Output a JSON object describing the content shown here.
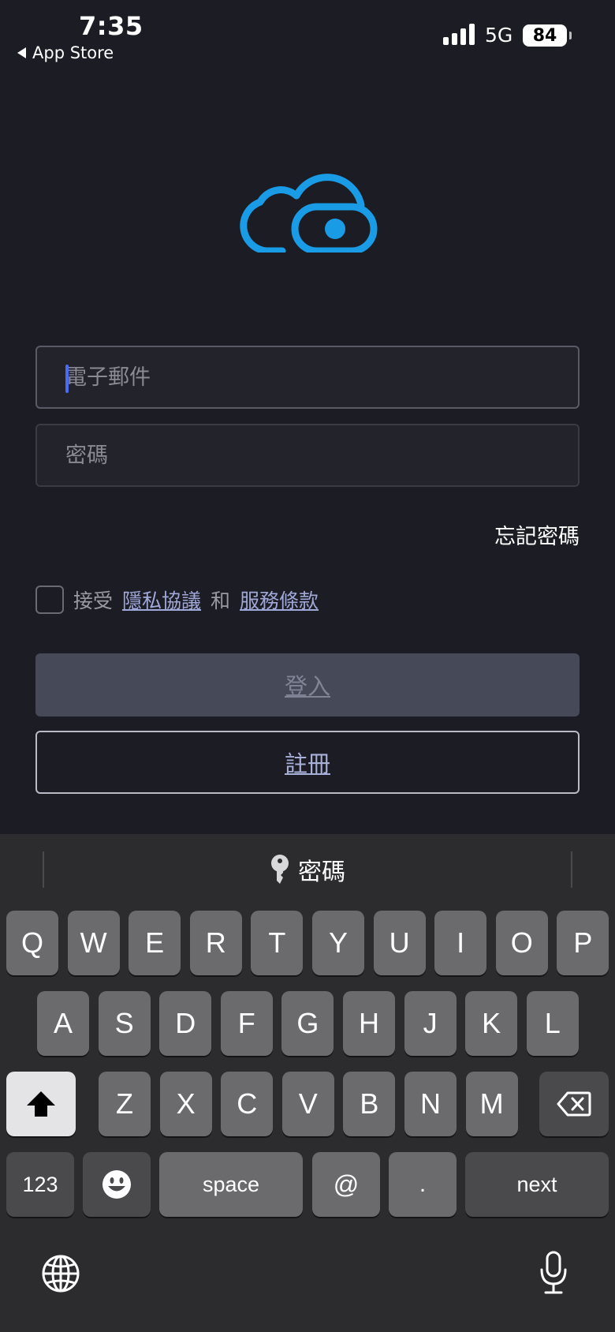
{
  "status": {
    "time": "7:35",
    "back_label": "App Store",
    "network": "5G",
    "battery": "84"
  },
  "form": {
    "email_placeholder": "電子郵件",
    "password_placeholder": "密碼",
    "forgot_label": "忘記密碼",
    "terms_prefix": "接受",
    "privacy_link": "隱私協議",
    "terms_and": "和",
    "service_link": "服務條款",
    "login_label": "登入",
    "register_label": "註冊"
  },
  "keyboard": {
    "autofill_label": "密碼",
    "row1": [
      "Q",
      "W",
      "E",
      "R",
      "T",
      "Y",
      "U",
      "I",
      "O",
      "P"
    ],
    "row2": [
      "A",
      "S",
      "D",
      "F",
      "G",
      "H",
      "J",
      "K",
      "L"
    ],
    "row3": [
      "Z",
      "X",
      "C",
      "V",
      "B",
      "N",
      "M"
    ],
    "numbers_label": "123",
    "space_label": "space",
    "at_label": "@",
    "dot_label": ".",
    "next_label": "next"
  },
  "colors": {
    "background": "#1c1c24",
    "accent": "#1a9be6",
    "caret": "#4a6cf5"
  },
  "icons": [
    "cloud-eye-logo",
    "key-icon",
    "shift-icon",
    "backspace-icon",
    "emoji-icon",
    "globe-icon",
    "microphone-icon"
  ]
}
